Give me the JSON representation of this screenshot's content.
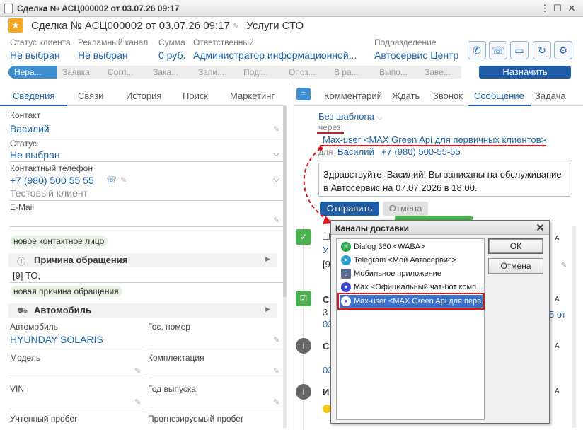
{
  "window": {
    "title": "Сделка № АСЦ000002 от 03.07.26 09:17"
  },
  "header": {
    "title": "Сделка № АСЦ000002 от 03.07.26 09:17",
    "service": "Услуги СТО"
  },
  "fields": [
    {
      "label": "Статус клиента",
      "value": "Не выбран"
    },
    {
      "label": "Рекламный канал",
      "value": "Не выбран"
    },
    {
      "label": "Сумма",
      "value": "0 руб."
    },
    {
      "label": "Ответственный",
      "value": "Администратор информационной..."
    },
    {
      "label": "Подразделение",
      "value": "Автосервис Центр"
    }
  ],
  "stages": [
    "Нера...",
    "Заявка",
    "Согл...",
    "Зака...",
    "Запи...",
    "Подг...",
    "Опоз...",
    "В ра...",
    "Выпо...",
    "Заве..."
  ],
  "assign_label": "Назначить",
  "left_tabs": [
    "Сведения",
    "Связи",
    "История",
    "Поиск",
    "Маркетинг"
  ],
  "contact": {
    "contact_label": "Контакт",
    "contact_value": "Василий",
    "status_label": "Статус",
    "status_value": "Не выбран",
    "phone_label": "Контактный телефон",
    "phone_value": "+7 (980) 500 55 55",
    "client_type": "Тестовый клиент",
    "email_label": "E-Mail",
    "tag": "новое контактное лицо"
  },
  "reason": {
    "title": "Причина обращения",
    "value": "[9] ТО;",
    "tag": "новая причина обращения"
  },
  "car": {
    "title": "Автомобиль",
    "car_label": "Автомобиль",
    "car_value": "HYUNDAY SOLARIS",
    "plate_label": "Гос. номер",
    "model_label": "Модель",
    "equip_label": "Комплектация",
    "vin_label": "VIN",
    "year_label": "Год выпуска",
    "mileage_label": "Учтенный пробег",
    "forecast_label": "Прогнозируемый пробег"
  },
  "right_tabs": [
    "Комментарий",
    "Ждать",
    "Звонок",
    "Сообщение",
    "Задача"
  ],
  "message": {
    "template": "Без шаблона",
    "via_label": "через",
    "channel": "Max-user <MAX Green Api для первичных клиентов>",
    "for_label": "для",
    "recipient": "Василий",
    "recipient_phone": "+7 (980) 500-55-55",
    "text_line1": "Здравствуйте, Василий! Вы записаны на обслуживание",
    "text_line2": "в Автосервис на 07.07.2026 в 18:00.",
    "send": "Отправить",
    "cancel": "Отмена"
  },
  "timeline": {
    "side_letters": [
      "А",
      "А",
      "А",
      "А",
      "А"
    ],
    "frag_15": "5 от",
    "frag_u": "У",
    "frag_9": "[9",
    "frag_c1": "С",
    "frag_3a": "3",
    "frag_03a": "03",
    "frag_c2": "С",
    "frag_03b": "03",
    "frag_i": "И"
  },
  "dialog": {
    "title": "Каналы доставки",
    "items": [
      {
        "label": "Dialog 360 <WABA>",
        "icon": "whatsapp-icon",
        "color": "#25a244"
      },
      {
        "label": "Telegram <Мой Автосервис>",
        "icon": "telegram-icon",
        "color": "#2a9fd6"
      },
      {
        "label": "Мобильное приложение",
        "icon": "mobile-app-icon",
        "color": "#5b6b8a"
      },
      {
        "label": "Max <Официальный чат-бот комп...",
        "icon": "max-icon",
        "color": "#3c4bd0"
      },
      {
        "label": "Max-user <MAX Green Api для перв...",
        "icon": "max-user-icon",
        "color": "#3c4bd0"
      }
    ],
    "ok": "ОК",
    "cancel": "Отмена"
  }
}
